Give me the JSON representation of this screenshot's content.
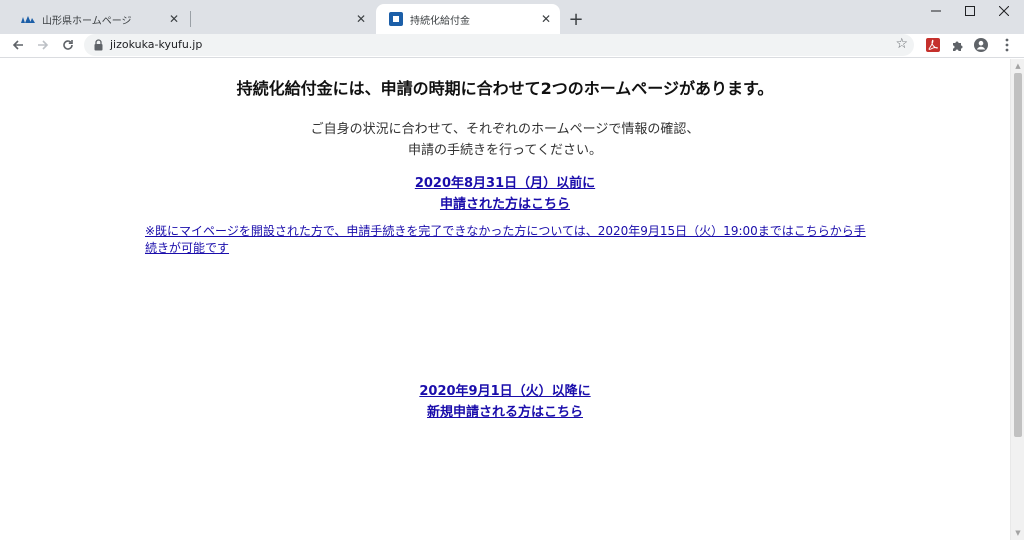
{
  "browser": {
    "tabs": [
      {
        "title": "山形県ホームページ",
        "favicon": "prefecture-logo-icon",
        "active": false
      },
      {
        "title": "",
        "favicon": "",
        "active": false
      },
      {
        "title": "持続化給付金",
        "favicon": "blue-square-icon",
        "active": true
      }
    ],
    "url": "jizokuka-kyufu.jp"
  },
  "page": {
    "heading": "持続化給付金には、申請の時期に合わせて2つのホームページがあります。",
    "intro_line1": "ご自身の状況に合わせて、それぞれのホームページで情報の確認、",
    "intro_line2": "申請の手続きを行ってください。",
    "link1_line1": "2020年8月31日（月）以前に",
    "link1_line2": "申請された方はこちら",
    "note": "※既にマイページを開設された方で、申請手続きを完了できなかった方については、2020年9月15日（火）19:00まではこちらから手続きが可能です",
    "link2_line1": "2020年9月1日（火）以降に",
    "link2_line2": "新規申請される方はこちら"
  },
  "colors": {
    "link": "#1a0dab",
    "tabstrip": "#dee1e6",
    "favicon_blue": "#1c5fa8"
  }
}
